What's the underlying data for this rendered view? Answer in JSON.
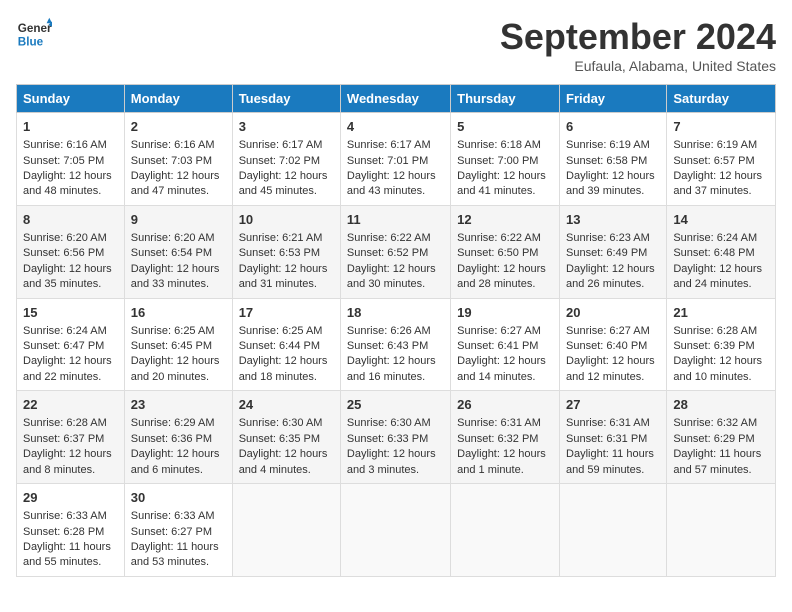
{
  "header": {
    "logo_line1": "General",
    "logo_line2": "Blue",
    "month": "September 2024",
    "location": "Eufaula, Alabama, United States"
  },
  "days_of_week": [
    "Sunday",
    "Monday",
    "Tuesday",
    "Wednesday",
    "Thursday",
    "Friday",
    "Saturday"
  ],
  "weeks": [
    [
      {
        "day": "1",
        "sunrise": "6:16 AM",
        "sunset": "7:05 PM",
        "daylight": "12 hours and 48 minutes."
      },
      {
        "day": "2",
        "sunrise": "6:16 AM",
        "sunset": "7:03 PM",
        "daylight": "12 hours and 47 minutes."
      },
      {
        "day": "3",
        "sunrise": "6:17 AM",
        "sunset": "7:02 PM",
        "daylight": "12 hours and 45 minutes."
      },
      {
        "day": "4",
        "sunrise": "6:17 AM",
        "sunset": "7:01 PM",
        "daylight": "12 hours and 43 minutes."
      },
      {
        "day": "5",
        "sunrise": "6:18 AM",
        "sunset": "7:00 PM",
        "daylight": "12 hours and 41 minutes."
      },
      {
        "day": "6",
        "sunrise": "6:19 AM",
        "sunset": "6:58 PM",
        "daylight": "12 hours and 39 minutes."
      },
      {
        "day": "7",
        "sunrise": "6:19 AM",
        "sunset": "6:57 PM",
        "daylight": "12 hours and 37 minutes."
      }
    ],
    [
      {
        "day": "8",
        "sunrise": "6:20 AM",
        "sunset": "6:56 PM",
        "daylight": "12 hours and 35 minutes."
      },
      {
        "day": "9",
        "sunrise": "6:20 AM",
        "sunset": "6:54 PM",
        "daylight": "12 hours and 33 minutes."
      },
      {
        "day": "10",
        "sunrise": "6:21 AM",
        "sunset": "6:53 PM",
        "daylight": "12 hours and 31 minutes."
      },
      {
        "day": "11",
        "sunrise": "6:22 AM",
        "sunset": "6:52 PM",
        "daylight": "12 hours and 30 minutes."
      },
      {
        "day": "12",
        "sunrise": "6:22 AM",
        "sunset": "6:50 PM",
        "daylight": "12 hours and 28 minutes."
      },
      {
        "day": "13",
        "sunrise": "6:23 AM",
        "sunset": "6:49 PM",
        "daylight": "12 hours and 26 minutes."
      },
      {
        "day": "14",
        "sunrise": "6:24 AM",
        "sunset": "6:48 PM",
        "daylight": "12 hours and 24 minutes."
      }
    ],
    [
      {
        "day": "15",
        "sunrise": "6:24 AM",
        "sunset": "6:47 PM",
        "daylight": "12 hours and 22 minutes."
      },
      {
        "day": "16",
        "sunrise": "6:25 AM",
        "sunset": "6:45 PM",
        "daylight": "12 hours and 20 minutes."
      },
      {
        "day": "17",
        "sunrise": "6:25 AM",
        "sunset": "6:44 PM",
        "daylight": "12 hours and 18 minutes."
      },
      {
        "day": "18",
        "sunrise": "6:26 AM",
        "sunset": "6:43 PM",
        "daylight": "12 hours and 16 minutes."
      },
      {
        "day": "19",
        "sunrise": "6:27 AM",
        "sunset": "6:41 PM",
        "daylight": "12 hours and 14 minutes."
      },
      {
        "day": "20",
        "sunrise": "6:27 AM",
        "sunset": "6:40 PM",
        "daylight": "12 hours and 12 minutes."
      },
      {
        "day": "21",
        "sunrise": "6:28 AM",
        "sunset": "6:39 PM",
        "daylight": "12 hours and 10 minutes."
      }
    ],
    [
      {
        "day": "22",
        "sunrise": "6:28 AM",
        "sunset": "6:37 PM",
        "daylight": "12 hours and 8 minutes."
      },
      {
        "day": "23",
        "sunrise": "6:29 AM",
        "sunset": "6:36 PM",
        "daylight": "12 hours and 6 minutes."
      },
      {
        "day": "24",
        "sunrise": "6:30 AM",
        "sunset": "6:35 PM",
        "daylight": "12 hours and 4 minutes."
      },
      {
        "day": "25",
        "sunrise": "6:30 AM",
        "sunset": "6:33 PM",
        "daylight": "12 hours and 3 minutes."
      },
      {
        "day": "26",
        "sunrise": "6:31 AM",
        "sunset": "6:32 PM",
        "daylight": "12 hours and 1 minute."
      },
      {
        "day": "27",
        "sunrise": "6:31 AM",
        "sunset": "6:31 PM",
        "daylight": "11 hours and 59 minutes."
      },
      {
        "day": "28",
        "sunrise": "6:32 AM",
        "sunset": "6:29 PM",
        "daylight": "11 hours and 57 minutes."
      }
    ],
    [
      {
        "day": "29",
        "sunrise": "6:33 AM",
        "sunset": "6:28 PM",
        "daylight": "11 hours and 55 minutes."
      },
      {
        "day": "30",
        "sunrise": "6:33 AM",
        "sunset": "6:27 PM",
        "daylight": "11 hours and 53 minutes."
      },
      null,
      null,
      null,
      null,
      null
    ]
  ]
}
